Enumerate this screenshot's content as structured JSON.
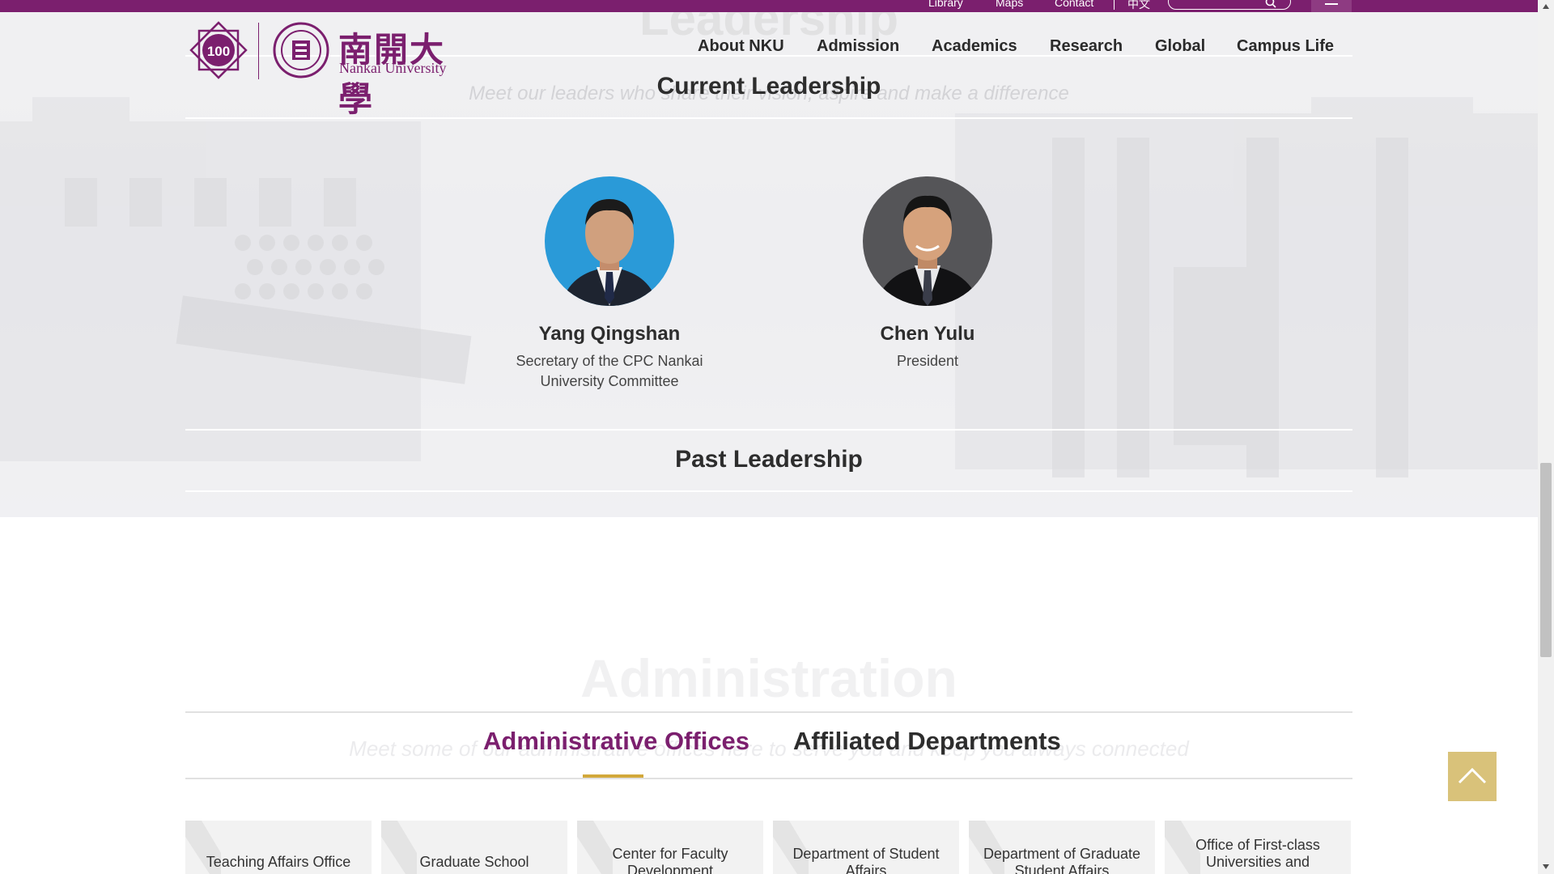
{
  "topbar": {
    "links": [
      "Library",
      "Maps",
      "Contact",
      "中文"
    ],
    "search_placeholder": ""
  },
  "header": {
    "logo_cn": "南開大學",
    "logo_en": "Nankai University",
    "nav": [
      "About NKU",
      "Admission",
      "Academics",
      "Research",
      "Global",
      "Campus Life"
    ]
  },
  "leadership": {
    "ghost_title": "Leadership",
    "ghost_subtitle": "Meet our leaders who share their vision, aspire and make a difference",
    "current_title": "Current Leadership",
    "leaders": [
      {
        "name": "Yang Qingshan",
        "title": "Secretary of the CPC Nankai University Committee"
      },
      {
        "name": "Chen Yulu",
        "title": "President"
      }
    ],
    "past_title": "Past Leadership"
  },
  "administration": {
    "ghost_title": "Administration",
    "ghost_subtitle": "Meet some of our administrative offices here to serve you and keep you always connected",
    "tabs": [
      "Administrative Offices",
      "Affiliated Departments"
    ],
    "active_tab": "Administrative Offices",
    "cards": [
      "Teaching Affairs Office",
      "Graduate School",
      "Center for Faculty Development",
      "Department of Student Affairs",
      "Department of Graduate Student Affairs",
      "Office of First-class Universities and"
    ]
  },
  "colors": {
    "brand_purple": "#7b1f6e",
    "accent_gold": "#d2a83b",
    "back_to_top": "#d9c27a"
  },
  "icons": {
    "search": "search-icon",
    "menu": "hamburger-menu-icon",
    "back_to_top": "chevron-up-icon"
  }
}
